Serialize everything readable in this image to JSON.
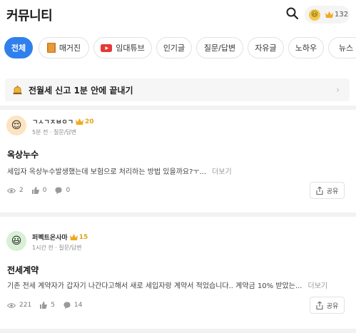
{
  "header": {
    "title": "커뮤니티",
    "search_icon": "search-icon",
    "user_points": "132",
    "user_avatar": "😃"
  },
  "tabs": [
    {
      "label": "전체",
      "active": true
    },
    {
      "label": "매거진",
      "icon": "magazine-icon"
    },
    {
      "label": "임대튜브",
      "icon": "youtube-icon"
    },
    {
      "label": "인기글"
    },
    {
      "label": "질문/답변"
    },
    {
      "label": "자유글"
    },
    {
      "label": "노하우"
    },
    {
      "label": "뉴스"
    }
  ],
  "banner": {
    "text": "전월세 신고 1분 안에 끝내기",
    "icon": "bell-icon",
    "chevron": "›"
  },
  "posts": [
    {
      "author": "ㄱㅅㄱㅈㅂㅇㄱ",
      "level": "20",
      "avatar": "😌",
      "meta": "5분 전 · 질문/답변",
      "title": "옥상누수",
      "body": "세입자 옥상누수발생했는데 보험으로 처리하는 방법 있을까요?ㅜ...",
      "more": "더보기",
      "views": "2",
      "likes": "0",
      "comments": "0",
      "share": "공유"
    },
    {
      "author": "퍼펙트온사마",
      "level": "15",
      "avatar": "😃",
      "meta": "1시간 전 · 질문/답변",
      "title": "전세계약",
      "body": "기존 전세 계약자가 갑자기 나간다고해서 새로 세입자랑 계약서 적었습니다.. 계약금 10% 받았는...",
      "more": "더보기",
      "views": "221",
      "likes": "5",
      "comments": "14",
      "share": "공유"
    }
  ],
  "colors": {
    "accent": "#2f80ed",
    "crown": "#f2a91c",
    "level": "#e0a31f"
  }
}
